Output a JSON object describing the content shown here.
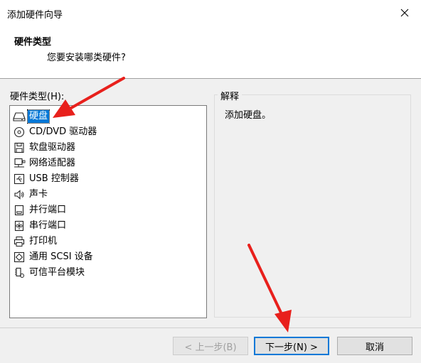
{
  "window": {
    "title": "添加硬件向导",
    "close_glyph": "✕"
  },
  "header": {
    "title": "硬件类型",
    "subtitle": "您要安装哪类硬件?"
  },
  "hardware_list": {
    "label": "硬件类型(H):",
    "items": [
      {
        "label": "硬盘",
        "icon": "hard-disk-icon",
        "selected": true
      },
      {
        "label": "CD/DVD 驱动器",
        "icon": "cd-dvd-icon"
      },
      {
        "label": "软盘驱动器",
        "icon": "floppy-icon"
      },
      {
        "label": "网络适配器",
        "icon": "network-adapter-icon"
      },
      {
        "label": "USB 控制器",
        "icon": "usb-icon"
      },
      {
        "label": "声卡",
        "icon": "speaker-icon"
      },
      {
        "label": "并行端口",
        "icon": "parallel-port-icon"
      },
      {
        "label": "串行端口",
        "icon": "serial-port-icon"
      },
      {
        "label": "打印机",
        "icon": "printer-icon"
      },
      {
        "label": "通用 SCSI 设备",
        "icon": "scsi-icon"
      },
      {
        "label": "可信平台模块",
        "icon": "tpm-icon"
      }
    ]
  },
  "explanation": {
    "title": "解释",
    "text": "添加硬盘。"
  },
  "buttons": {
    "back": "< 上一步(B)",
    "next": "下一步(N) >",
    "cancel": "取消"
  },
  "colors": {
    "selection": "#0078d7",
    "annotation_arrow": "#e8201c"
  }
}
